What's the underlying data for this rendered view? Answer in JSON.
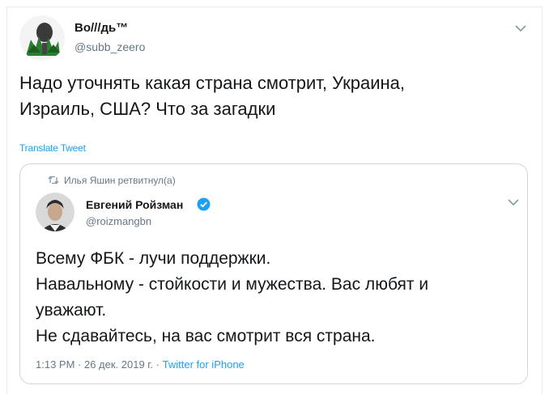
{
  "tweet": {
    "author_name": "Во///дь™",
    "author_handle": "@subb_zeero",
    "text_line1": "Надо уточнять какая страна смотрит, Украина,",
    "text_line2": "Израиль, США? Что за загадки",
    "translate_label": "Translate Tweet"
  },
  "quoted": {
    "retweet_notice": "Илья Яшин ретвитнул(а)",
    "author_name": "Евгений Ройзман",
    "author_handle": "@roizmangbn",
    "lines": [
      "Всему ФБК - лучи поддержки.",
      "Навальному - стойкости и мужества. Вас любят и",
      "уважают.",
      "Не сдавайтесь, на вас смотрит вся страна."
    ],
    "time": "1:13 PM · 26 дек. 2019 г. · ",
    "source": "Twitter for iPhone"
  },
  "colors": {
    "accent": "#1da1f2",
    "muted": "#657786",
    "border": "#ccd6dd"
  },
  "icons": [
    "avatar-main",
    "chevron-down-icon",
    "retweet-icon",
    "verified-badge-icon"
  ]
}
